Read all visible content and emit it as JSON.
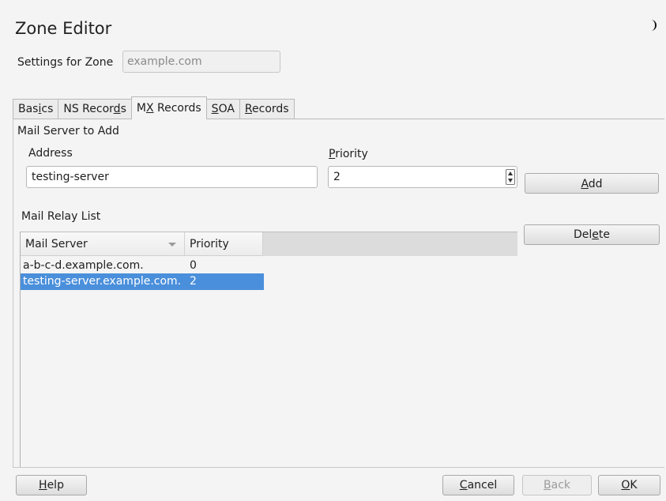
{
  "window": {
    "title": "Zone Editor"
  },
  "zone": {
    "label": "Settings for Zone",
    "value": "example.com"
  },
  "tabs": [
    {
      "label": "Basics",
      "pre": "Bas",
      "mn": "i",
      "post": "cs"
    },
    {
      "label": "NS Records",
      "pre": "NS Recor",
      "mn": "d",
      "post": "s"
    },
    {
      "label": "MX Records",
      "pre": "M",
      "mn": "X",
      "post": " Records"
    },
    {
      "label": "SOA",
      "pre": "",
      "mn": "S",
      "post": "OA"
    },
    {
      "label": "Records",
      "pre": "",
      "mn": "R",
      "post": "ecords"
    }
  ],
  "mail_server_to_add": {
    "section_label": "Mail Server to Add",
    "address_label": "Address",
    "address_value": "testing-server",
    "priority_label": "Priority",
    "priority_label_mn": "P",
    "priority_label_rest": "riority",
    "priority_value": "2"
  },
  "buttons": {
    "add": {
      "pre": "",
      "mn": "A",
      "post": "dd"
    },
    "delete": {
      "pre": "Del",
      "mn": "e",
      "post": "te"
    },
    "help": {
      "pre": "",
      "mn": "H",
      "post": "elp"
    },
    "cancel": {
      "pre": "",
      "mn": "C",
      "post": "ancel"
    },
    "back": {
      "pre": "",
      "mn": "B",
      "post": "ack"
    },
    "ok": {
      "pre": "",
      "mn": "O",
      "post": "K"
    }
  },
  "relay_list": {
    "label": "Mail Relay List",
    "columns": [
      "Mail Server",
      "Priority"
    ],
    "rows": [
      {
        "server": "a-b-c-d.example.com.",
        "priority": "0",
        "selected": false
      },
      {
        "server": "testing-server.example.com.",
        "priority": "2",
        "selected": true
      }
    ]
  },
  "colors": {
    "selection": "#4a8fdb",
    "background": "#f4f4f4"
  },
  "icons": {
    "theme_toggle": "moon-icon",
    "sort": "sort-desc-icon",
    "spinner": "spin-arrows-icon"
  }
}
